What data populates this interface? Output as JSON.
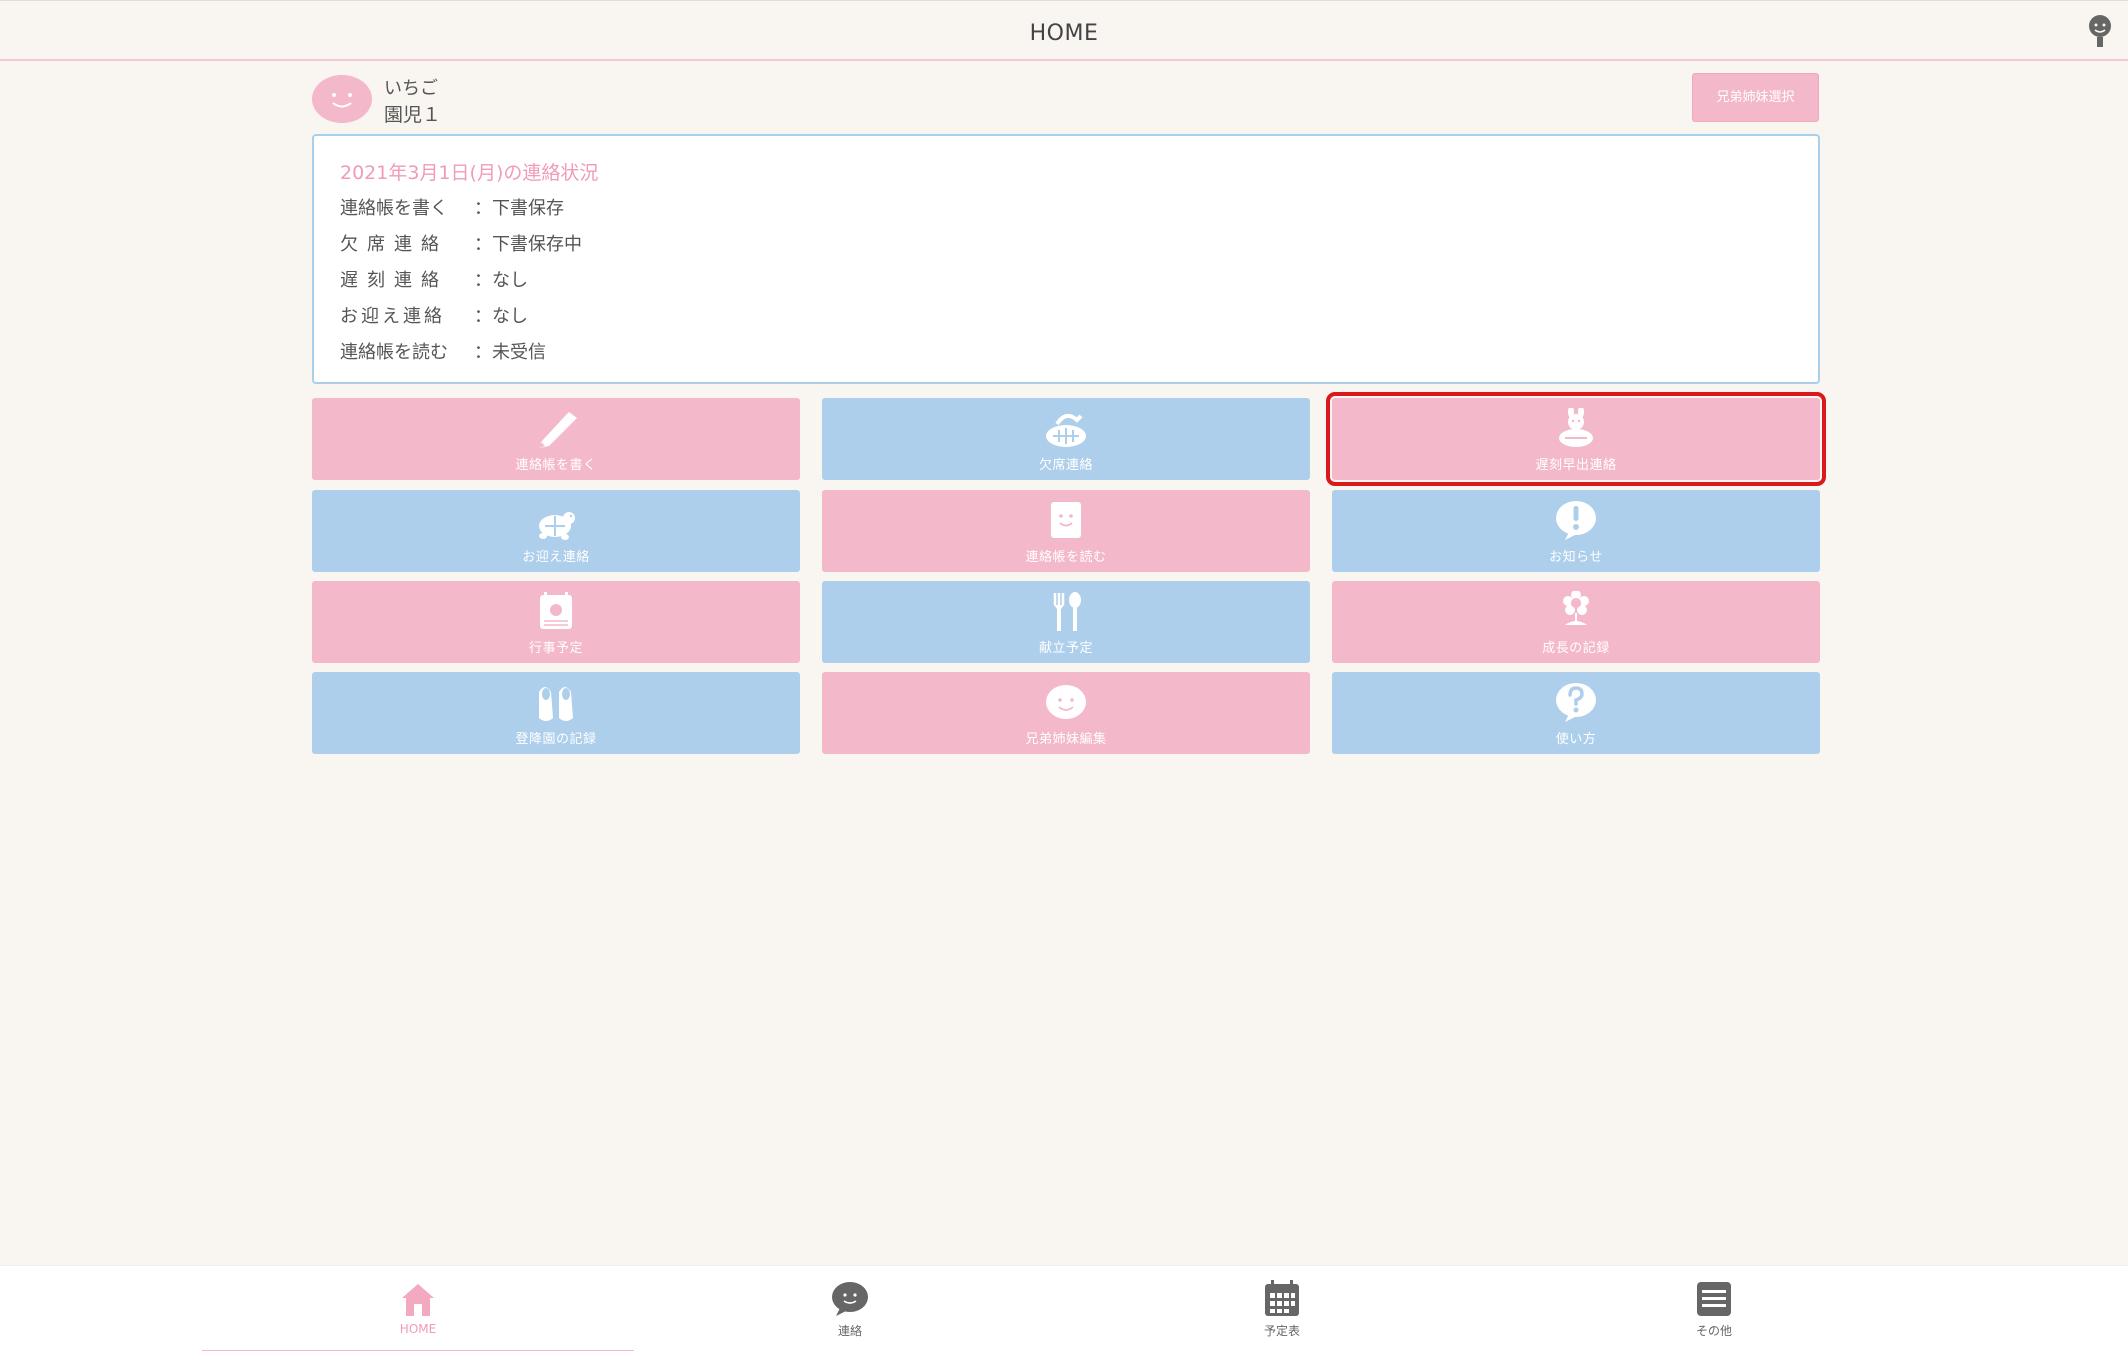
{
  "header": {
    "title": "HOME"
  },
  "child": {
    "name": "いちご",
    "class_label": "園児１"
  },
  "sibling_select_label": "兄弟姉妹選択",
  "status": {
    "title": "2021年3月1日(月)の連絡状況",
    "rows": [
      {
        "key": "連絡帳を書く",
        "value": "：下書保存"
      },
      {
        "key": "欠席連絡",
        "value": "：下書保存中"
      },
      {
        "key": "遅刻連絡",
        "value": "：なし"
      },
      {
        "key": "お迎え連絡",
        "value": "：なし"
      },
      {
        "key": "連絡帳を読む",
        "value": "：未受信"
      }
    ]
  },
  "tiles": [
    {
      "label": "連絡帳を書く",
      "color": "#f4b8cb",
      "icon": "pencil-icon"
    },
    {
      "label": "欠席連絡",
      "color": "#aecfeb",
      "icon": "turtle-sleeping-icon"
    },
    {
      "label": "遅刻早出連絡",
      "color": "#f4b8cb",
      "icon": "rabbit-turtle-icon",
      "selected": true
    },
    {
      "label": "お迎え連絡",
      "color": "#aecfeb",
      "icon": "turtle-icon"
    },
    {
      "label": "連絡帳を読む",
      "color": "#f4b8cb",
      "icon": "notebook-icon"
    },
    {
      "label": "お知らせ",
      "color": "#aecfeb",
      "icon": "exclamation-bubble-icon"
    },
    {
      "label": "行事予定",
      "color": "#f4b8cb",
      "icon": "calendar-icon"
    },
    {
      "label": "献立予定",
      "color": "#aecfeb",
      "icon": "fork-spoon-icon"
    },
    {
      "label": "成長の記録",
      "color": "#f4b8cb",
      "icon": "flower-icon"
    },
    {
      "label": "登降園の記録",
      "color": "#aecfeb",
      "icon": "shoes-icon"
    },
    {
      "label": "兄弟姉妹編集",
      "color": "#f4b8cb",
      "icon": "smile-bubble-icon"
    },
    {
      "label": "使い方",
      "color": "#aecfeb",
      "icon": "question-bubble-icon"
    }
  ],
  "footer": {
    "items": [
      {
        "label": "HOME",
        "icon": "house-icon",
        "active": true
      },
      {
        "label": "連絡",
        "icon": "chat-icon"
      },
      {
        "label": "予定表",
        "icon": "calendar-grid-icon"
      },
      {
        "label": "その他",
        "icon": "menu-list-icon"
      }
    ]
  },
  "colors": {
    "pink": "#f4b8cb",
    "blue": "#aecfeb",
    "accent_pink": "#f19cb6",
    "selected_outline": "#d9191c"
  }
}
